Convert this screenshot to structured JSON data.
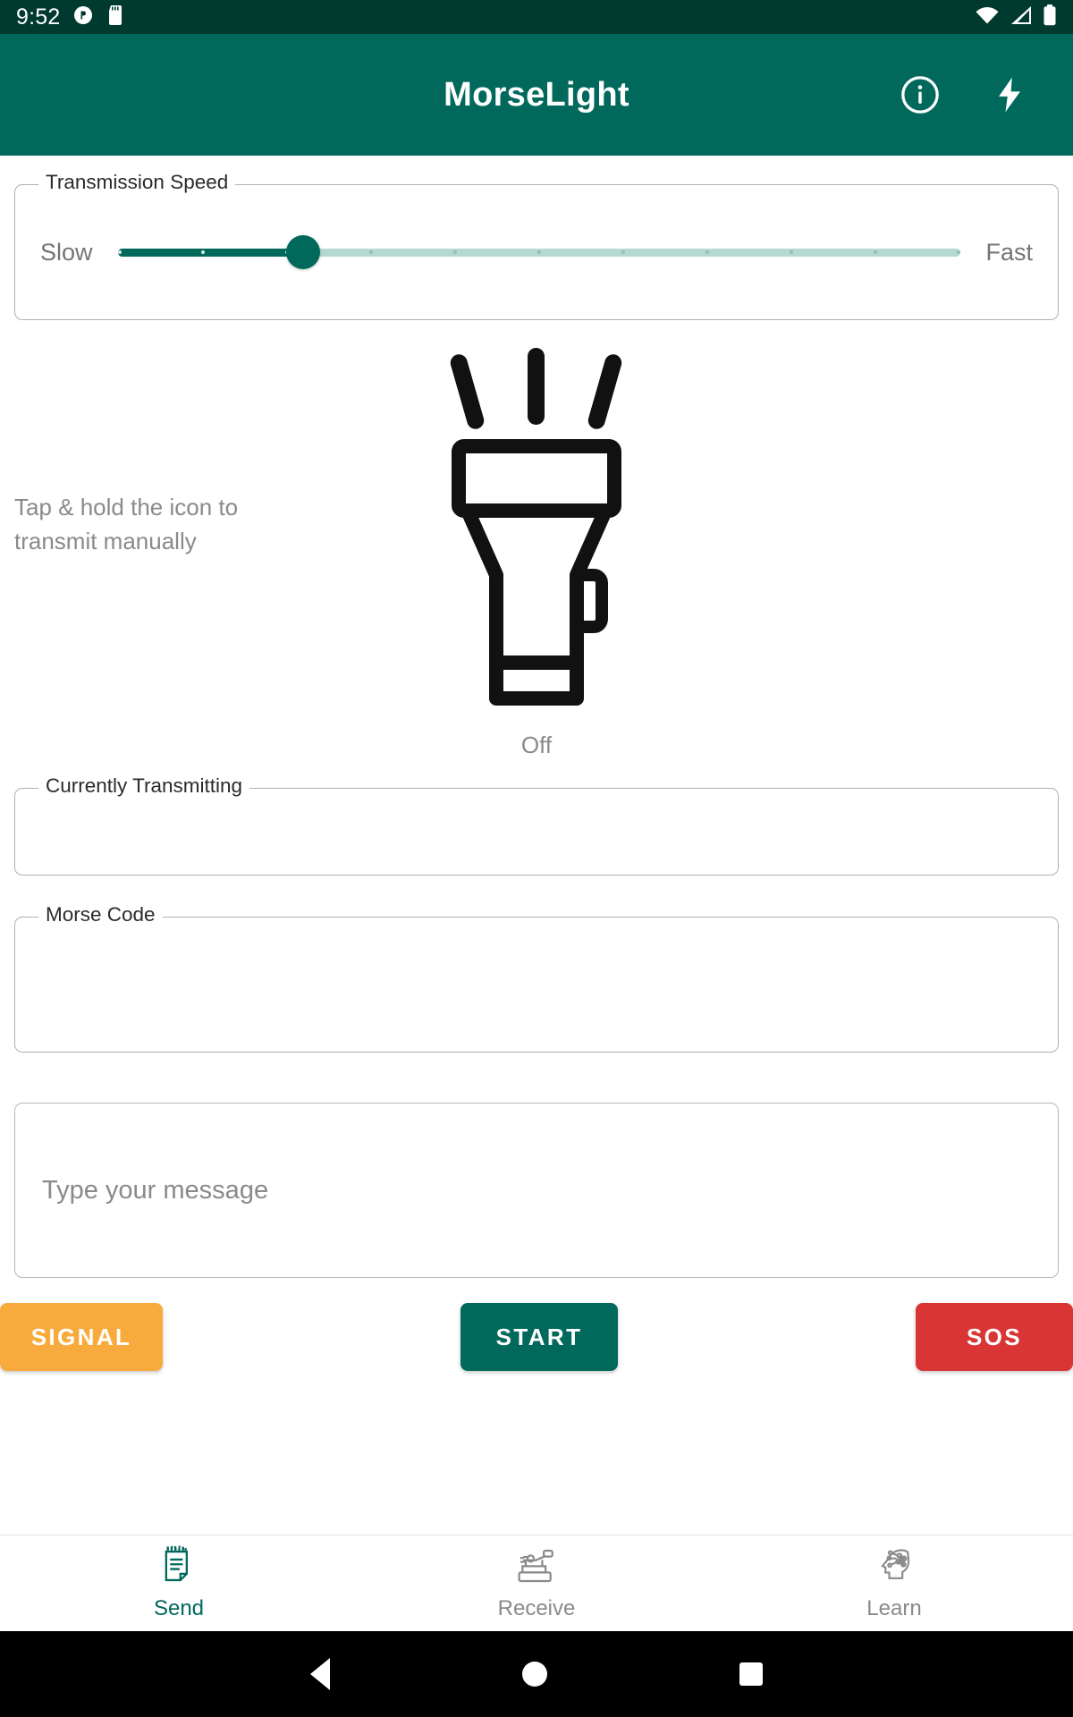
{
  "status_bar": {
    "time": "9:52",
    "icons": [
      "app-notification-icon",
      "sd-card-icon",
      "wifi-icon",
      "cellular-signal-icon",
      "battery-icon"
    ],
    "background": "#003A2F"
  },
  "app_bar": {
    "title": "MorseLight",
    "background": "#00695C",
    "actions": [
      {
        "name": "info-icon",
        "label": "Info"
      },
      {
        "name": "flash-bolt-icon",
        "label": "Flash"
      }
    ]
  },
  "speed": {
    "legend": "Transmission Speed",
    "min_label": "Slow",
    "max_label": "Fast",
    "value_percent": 22,
    "tick_count": 11,
    "track_color": "#b5d8d1",
    "fill_color": "#00695C"
  },
  "torch": {
    "hint": "Tap & hold the icon to transmit manually",
    "icon": "flashlight-icon",
    "status": "Off"
  },
  "transmitting": {
    "legend": "Currently Transmitting",
    "value": ""
  },
  "morse": {
    "legend": "Morse Code",
    "value": ""
  },
  "message": {
    "placeholder": "Type your message",
    "value": ""
  },
  "buttons": [
    {
      "label": "SIGNAL",
      "color": "#F8AB3C",
      "name": "signal-button"
    },
    {
      "label": "START",
      "color": "#00695C",
      "name": "start-button"
    },
    {
      "label": "SOS",
      "color": "#D93535",
      "name": "sos-button"
    }
  ],
  "bottom_nav": [
    {
      "label": "Send",
      "icon": "note-document-icon",
      "active": true
    },
    {
      "label": "Receive",
      "icon": "telegraph-key-icon",
      "active": false
    },
    {
      "label": "Learn",
      "icon": "brain-head-icon",
      "active": false
    }
  ],
  "android_nav": {
    "back": "back-triangle-icon",
    "home": "home-circle-icon",
    "recents": "recents-square-icon"
  },
  "colors": {
    "status_bar": "#003A2F",
    "primary": "#00695C",
    "accent_orange": "#F8AB3C",
    "danger_red": "#D93535",
    "muted_text": "#8a8a8a"
  }
}
